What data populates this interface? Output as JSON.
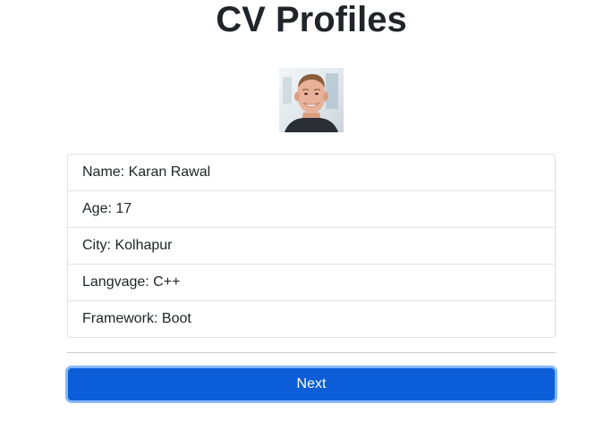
{
  "page": {
    "title": "CV Profiles"
  },
  "profile": {
    "photo_alt": "profile photo",
    "details": [
      {
        "label": "Name: Karan Rawal"
      },
      {
        "label": "Age: 17"
      },
      {
        "label": "City: Kolhapur"
      },
      {
        "label": "Langvage: C++"
      },
      {
        "label": "Framework: Boot"
      }
    ]
  },
  "actions": {
    "next_label": "Next"
  },
  "colors": {
    "button_bg": "#0b5ed7",
    "button_focus_ring": "#86b7fe",
    "border": "#dee2e6",
    "text": "#212529"
  }
}
